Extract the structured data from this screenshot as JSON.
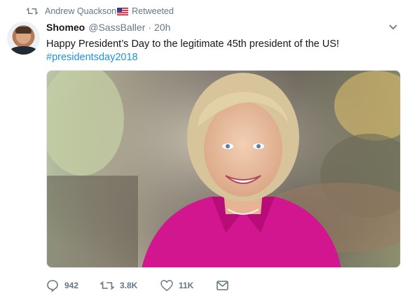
{
  "retweet": {
    "retweeter_name": "Andrew Quackson",
    "label": "Retweeted"
  },
  "tweet": {
    "display_name": "Shomeo",
    "handle": "@SassBaller",
    "separator": "·",
    "time": "20h",
    "text": "Happy President’s Day to the legitimate 45th president of the US!",
    "hashtag": "#presidentsday2018"
  },
  "actions": {
    "replies": "942",
    "retweets": "3.8K",
    "likes": "11K"
  },
  "colors": {
    "link": "#1b95e0",
    "muted": "#657786",
    "text": "#14171a",
    "jacket": "#d2168f"
  },
  "icons": {
    "retweet": "retweet-icon",
    "flag": "us-flag-icon",
    "more": "chevron-down-icon",
    "reply": "reply-icon",
    "like": "heart-icon",
    "dm": "envelope-icon"
  }
}
